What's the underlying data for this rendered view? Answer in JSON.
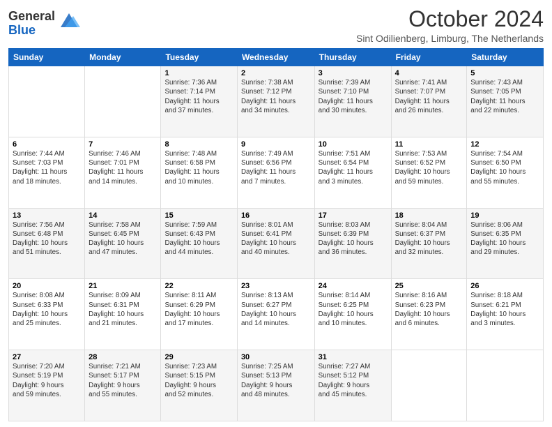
{
  "header": {
    "logo_line1": "General",
    "logo_line2": "Blue",
    "month_title": "October 2024",
    "location": "Sint Odilienberg, Limburg, The Netherlands"
  },
  "weekdays": [
    "Sunday",
    "Monday",
    "Tuesday",
    "Wednesday",
    "Thursday",
    "Friday",
    "Saturday"
  ],
  "weeks": [
    [
      {
        "day": "",
        "info": ""
      },
      {
        "day": "",
        "info": ""
      },
      {
        "day": "1",
        "info": "Sunrise: 7:36 AM\nSunset: 7:14 PM\nDaylight: 11 hours\nand 37 minutes."
      },
      {
        "day": "2",
        "info": "Sunrise: 7:38 AM\nSunset: 7:12 PM\nDaylight: 11 hours\nand 34 minutes."
      },
      {
        "day": "3",
        "info": "Sunrise: 7:39 AM\nSunset: 7:10 PM\nDaylight: 11 hours\nand 30 minutes."
      },
      {
        "day": "4",
        "info": "Sunrise: 7:41 AM\nSunset: 7:07 PM\nDaylight: 11 hours\nand 26 minutes."
      },
      {
        "day": "5",
        "info": "Sunrise: 7:43 AM\nSunset: 7:05 PM\nDaylight: 11 hours\nand 22 minutes."
      }
    ],
    [
      {
        "day": "6",
        "info": "Sunrise: 7:44 AM\nSunset: 7:03 PM\nDaylight: 11 hours\nand 18 minutes."
      },
      {
        "day": "7",
        "info": "Sunrise: 7:46 AM\nSunset: 7:01 PM\nDaylight: 11 hours\nand 14 minutes."
      },
      {
        "day": "8",
        "info": "Sunrise: 7:48 AM\nSunset: 6:58 PM\nDaylight: 11 hours\nand 10 minutes."
      },
      {
        "day": "9",
        "info": "Sunrise: 7:49 AM\nSunset: 6:56 PM\nDaylight: 11 hours\nand 7 minutes."
      },
      {
        "day": "10",
        "info": "Sunrise: 7:51 AM\nSunset: 6:54 PM\nDaylight: 11 hours\nand 3 minutes."
      },
      {
        "day": "11",
        "info": "Sunrise: 7:53 AM\nSunset: 6:52 PM\nDaylight: 10 hours\nand 59 minutes."
      },
      {
        "day": "12",
        "info": "Sunrise: 7:54 AM\nSunset: 6:50 PM\nDaylight: 10 hours\nand 55 minutes."
      }
    ],
    [
      {
        "day": "13",
        "info": "Sunrise: 7:56 AM\nSunset: 6:48 PM\nDaylight: 10 hours\nand 51 minutes."
      },
      {
        "day": "14",
        "info": "Sunrise: 7:58 AM\nSunset: 6:45 PM\nDaylight: 10 hours\nand 47 minutes."
      },
      {
        "day": "15",
        "info": "Sunrise: 7:59 AM\nSunset: 6:43 PM\nDaylight: 10 hours\nand 44 minutes."
      },
      {
        "day": "16",
        "info": "Sunrise: 8:01 AM\nSunset: 6:41 PM\nDaylight: 10 hours\nand 40 minutes."
      },
      {
        "day": "17",
        "info": "Sunrise: 8:03 AM\nSunset: 6:39 PM\nDaylight: 10 hours\nand 36 minutes."
      },
      {
        "day": "18",
        "info": "Sunrise: 8:04 AM\nSunset: 6:37 PM\nDaylight: 10 hours\nand 32 minutes."
      },
      {
        "day": "19",
        "info": "Sunrise: 8:06 AM\nSunset: 6:35 PM\nDaylight: 10 hours\nand 29 minutes."
      }
    ],
    [
      {
        "day": "20",
        "info": "Sunrise: 8:08 AM\nSunset: 6:33 PM\nDaylight: 10 hours\nand 25 minutes."
      },
      {
        "day": "21",
        "info": "Sunrise: 8:09 AM\nSunset: 6:31 PM\nDaylight: 10 hours\nand 21 minutes."
      },
      {
        "day": "22",
        "info": "Sunrise: 8:11 AM\nSunset: 6:29 PM\nDaylight: 10 hours\nand 17 minutes."
      },
      {
        "day": "23",
        "info": "Sunrise: 8:13 AM\nSunset: 6:27 PM\nDaylight: 10 hours\nand 14 minutes."
      },
      {
        "day": "24",
        "info": "Sunrise: 8:14 AM\nSunset: 6:25 PM\nDaylight: 10 hours\nand 10 minutes."
      },
      {
        "day": "25",
        "info": "Sunrise: 8:16 AM\nSunset: 6:23 PM\nDaylight: 10 hours\nand 6 minutes."
      },
      {
        "day": "26",
        "info": "Sunrise: 8:18 AM\nSunset: 6:21 PM\nDaylight: 10 hours\nand 3 minutes."
      }
    ],
    [
      {
        "day": "27",
        "info": "Sunrise: 7:20 AM\nSunset: 5:19 PM\nDaylight: 9 hours\nand 59 minutes."
      },
      {
        "day": "28",
        "info": "Sunrise: 7:21 AM\nSunset: 5:17 PM\nDaylight: 9 hours\nand 55 minutes."
      },
      {
        "day": "29",
        "info": "Sunrise: 7:23 AM\nSunset: 5:15 PM\nDaylight: 9 hours\nand 52 minutes."
      },
      {
        "day": "30",
        "info": "Sunrise: 7:25 AM\nSunset: 5:13 PM\nDaylight: 9 hours\nand 48 minutes."
      },
      {
        "day": "31",
        "info": "Sunrise: 7:27 AM\nSunset: 5:12 PM\nDaylight: 9 hours\nand 45 minutes."
      },
      {
        "day": "",
        "info": ""
      },
      {
        "day": "",
        "info": ""
      }
    ]
  ]
}
